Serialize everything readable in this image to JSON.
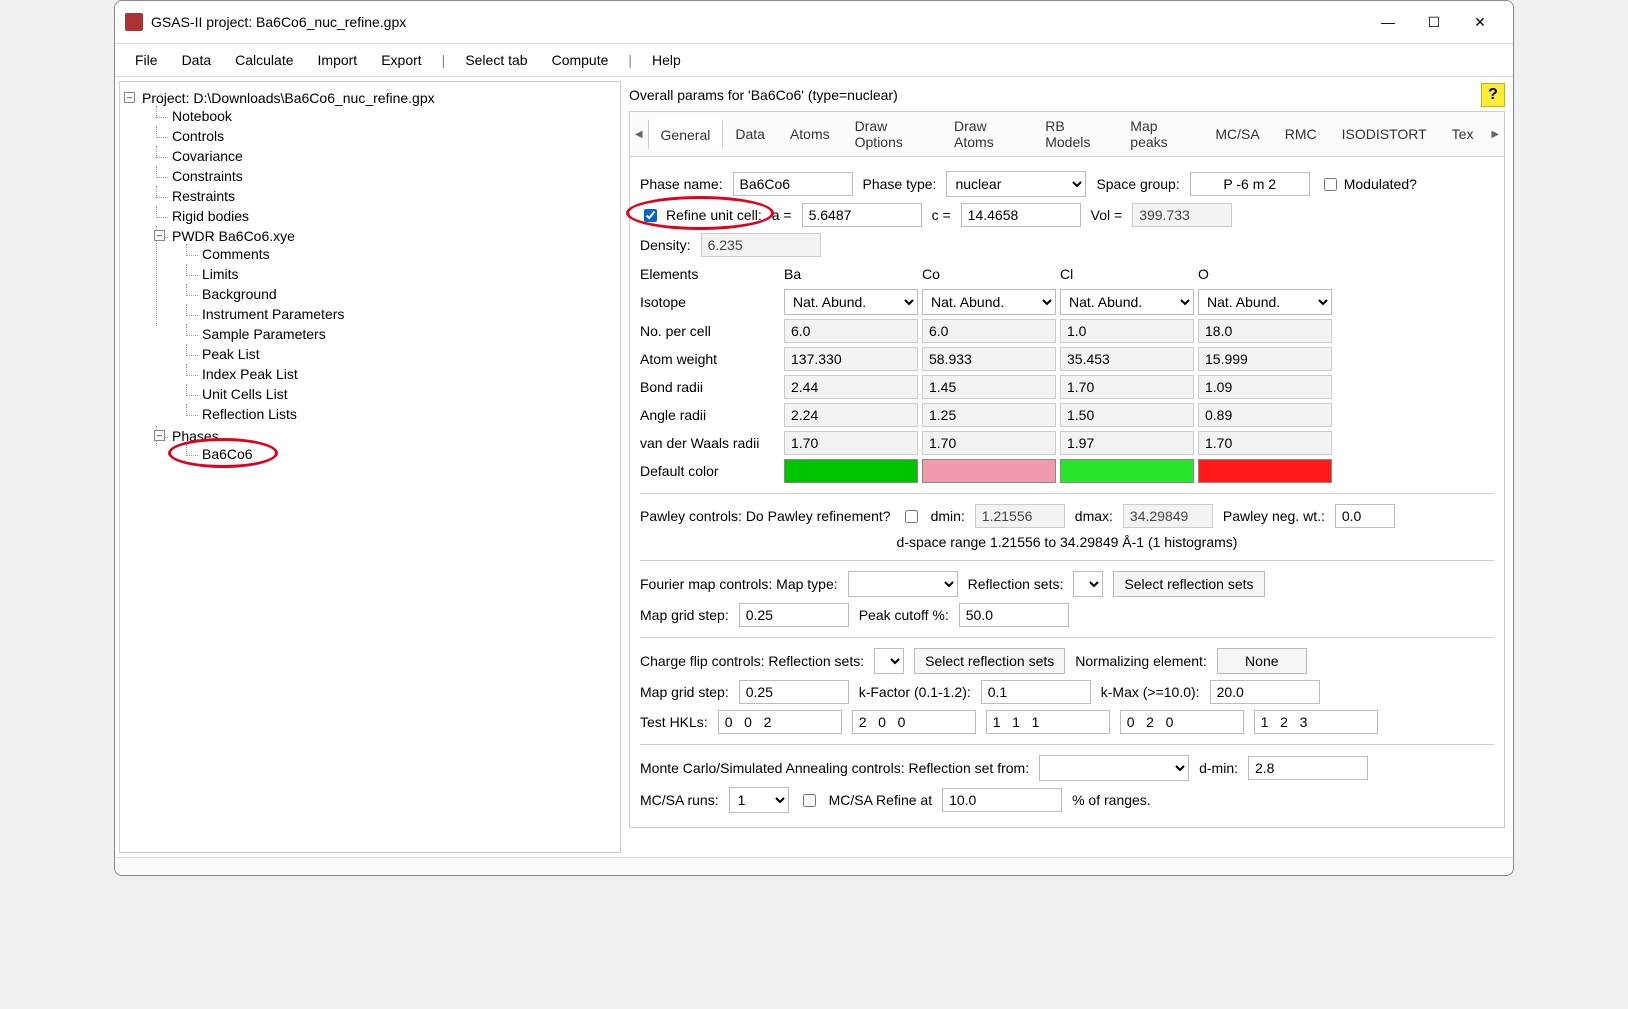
{
  "window": {
    "title": "GSAS-II project: Ba6Co6_nuc_refine.gpx"
  },
  "menubar": [
    "File",
    "Data",
    "Calculate",
    "Import",
    "Export",
    "|",
    "Select tab",
    "Compute",
    "|",
    "Help"
  ],
  "tree": {
    "root": "Project: D:\\Downloads\\Ba6Co6_nuc_refine.gpx",
    "top_items": [
      "Notebook",
      "Controls",
      "Covariance",
      "Constraints",
      "Restraints",
      "Rigid bodies"
    ],
    "pwdr": {
      "label": "PWDR Ba6Co6.xye",
      "children": [
        "Comments",
        "Limits",
        "Background",
        "Instrument Parameters",
        "Sample Parameters",
        "Peak List",
        "Index Peak List",
        "Unit Cells List",
        "Reflection Lists"
      ]
    },
    "phases": {
      "label": "Phases",
      "children": [
        "Ba6Co6"
      ]
    }
  },
  "overall_title": "Overall params for 'Ba6Co6' (type=nuclear)",
  "help_label": "?",
  "tabs": [
    "General",
    "Data",
    "Atoms",
    "Draw Options",
    "Draw Atoms",
    "RB Models",
    "Map peaks",
    "MC/SA",
    "RMC",
    "ISODISTORT",
    "Tex"
  ],
  "phase": {
    "name_label": "Phase name:",
    "name": "Ba6Co6",
    "type_label": "Phase type:",
    "type": "nuclear",
    "sg_label": "Space group:",
    "sg": "P -6 m 2",
    "modulated_label": "Modulated?",
    "refine_label": "Refine unit cell:",
    "a_label": "a =",
    "a": "5.6487",
    "c_label": "c =",
    "c": "14.4658",
    "vol_label": "Vol =",
    "vol": "399.733",
    "density_label": "Density:",
    "density": "6.235"
  },
  "elements": {
    "row_labels": [
      "Elements",
      "Isotope",
      "No. per cell",
      "Atom weight",
      "Bond radii",
      "Angle radii",
      "van der Waals radii",
      "Default color"
    ],
    "cols": [
      {
        "el": "Ba",
        "iso": "Nat. Abund.",
        "npc": "6.0",
        "aw": "137.330",
        "br": "2.44",
        "ar": "2.24",
        "vdw": "1.70",
        "color": "#00c400"
      },
      {
        "el": "Co",
        "iso": "Nat. Abund.",
        "npc": "6.0",
        "aw": "58.933",
        "br": "1.45",
        "ar": "1.25",
        "vdw": "1.70",
        "color": "#f19aae"
      },
      {
        "el": "Cl",
        "iso": "Nat. Abund.",
        "npc": "1.0",
        "aw": "35.453",
        "br": "1.70",
        "ar": "1.50",
        "vdw": "1.97",
        "color": "#28e52b"
      },
      {
        "el": "O",
        "iso": "Nat. Abund.",
        "npc": "18.0",
        "aw": "15.999",
        "br": "1.09",
        "ar": "0.89",
        "vdw": "1.70",
        "color": "#ff1a1a"
      }
    ]
  },
  "pawley": {
    "label": "Pawley controls:  Do Pawley refinement?",
    "dmin_label": "dmin:",
    "dmin": "1.21556",
    "dmax_label": "dmax:",
    "dmax": "34.29849",
    "negwt_label": "Pawley neg. wt.:",
    "negwt": "0.0",
    "range": "d-space range 1.21556 to 34.29849 Å-1 (1 histograms)"
  },
  "fourier": {
    "label": "Fourier map controls: Map type:",
    "refl_label": "Reflection sets:",
    "select_btn": "Select reflection sets",
    "grid_label": "Map grid step:",
    "grid": "0.25",
    "cutoff_label": "Peak cutoff %:",
    "cutoff": "50.0"
  },
  "flip": {
    "label": "Charge flip controls: Reflection sets:",
    "select_btn": "Select reflection sets",
    "norm_label": "Normalizing element:",
    "norm_btn": "None",
    "grid_label": "Map grid step:",
    "grid": "0.25",
    "kf_label": "k-Factor (0.1-1.2):",
    "kf": "0.1",
    "kmax_label": "k-Max (>=10.0):",
    "kmax": "20.0",
    "hkl_label": "Test HKLs:",
    "hkls": [
      "0   0   2",
      "2   0   0",
      "1   1   1",
      "0   2   0",
      "1   2   3"
    ]
  },
  "mcsa": {
    "label": "Monte Carlo/Simulated Annealing controls: Reflection set from:",
    "dmin_label": "d-min:",
    "dmin": "2.8",
    "runs_label": "MC/SA runs:",
    "runs": "1",
    "refine_label": "MC/SA Refine at",
    "refine_val": "10.0",
    "ranges_label": "% of ranges."
  }
}
